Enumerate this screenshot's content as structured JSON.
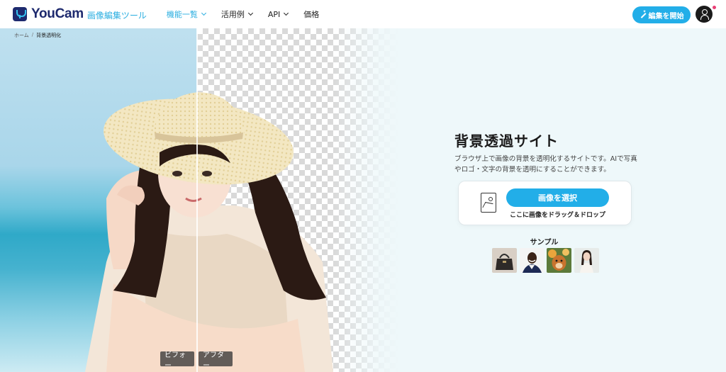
{
  "header": {
    "logo_text": "YouCam",
    "logo_sub": "画像編集ツール",
    "nav": [
      {
        "label": "機能一覧",
        "has_dropdown": true,
        "active": true
      },
      {
        "label": "活用例",
        "has_dropdown": true,
        "active": false
      },
      {
        "label": "API",
        "has_dropdown": true,
        "active": false
      },
      {
        "label": "価格",
        "has_dropdown": false,
        "active": false
      }
    ],
    "edit_button": "編集を開始"
  },
  "breadcrumb": {
    "home": "ホーム",
    "separator": "/",
    "current": "背景透明化"
  },
  "hero": {
    "before_label": "ビフォー",
    "after_label": "アフター"
  },
  "main": {
    "title": "背景透過サイト",
    "description": "ブラウザ上で画像の背景を透明化するサイトです。AIで写真やロゴ・文字の背景を透明にすることができます。",
    "select_button": "画像を選択",
    "drop_text": "ここに画像をドラッグ＆ドロップ",
    "sample_label": "サンプル",
    "samples": [
      "handbag-sample",
      "man-sample",
      "dog-sample",
      "woman-sample"
    ]
  },
  "colors": {
    "accent": "#22aee8",
    "brand_navy": "#1e2a6e",
    "panel_bg": "#eef8fa",
    "notification": "#e94076"
  }
}
